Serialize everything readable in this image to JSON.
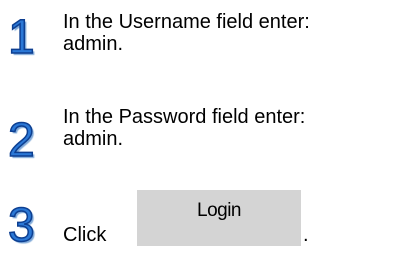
{
  "steps": [
    {
      "number": "1",
      "line1": "In the Username field enter:",
      "line2": "admin."
    },
    {
      "number": "2",
      "line1": "In the Password field enter:",
      "line2": "admin."
    },
    {
      "number": "3",
      "prefix": "Click",
      "button_label": "Login",
      "suffix": "."
    }
  ],
  "colors": {
    "step_number": "#2b78d6",
    "button_background": "#d4d4d4",
    "text": "#000000"
  }
}
